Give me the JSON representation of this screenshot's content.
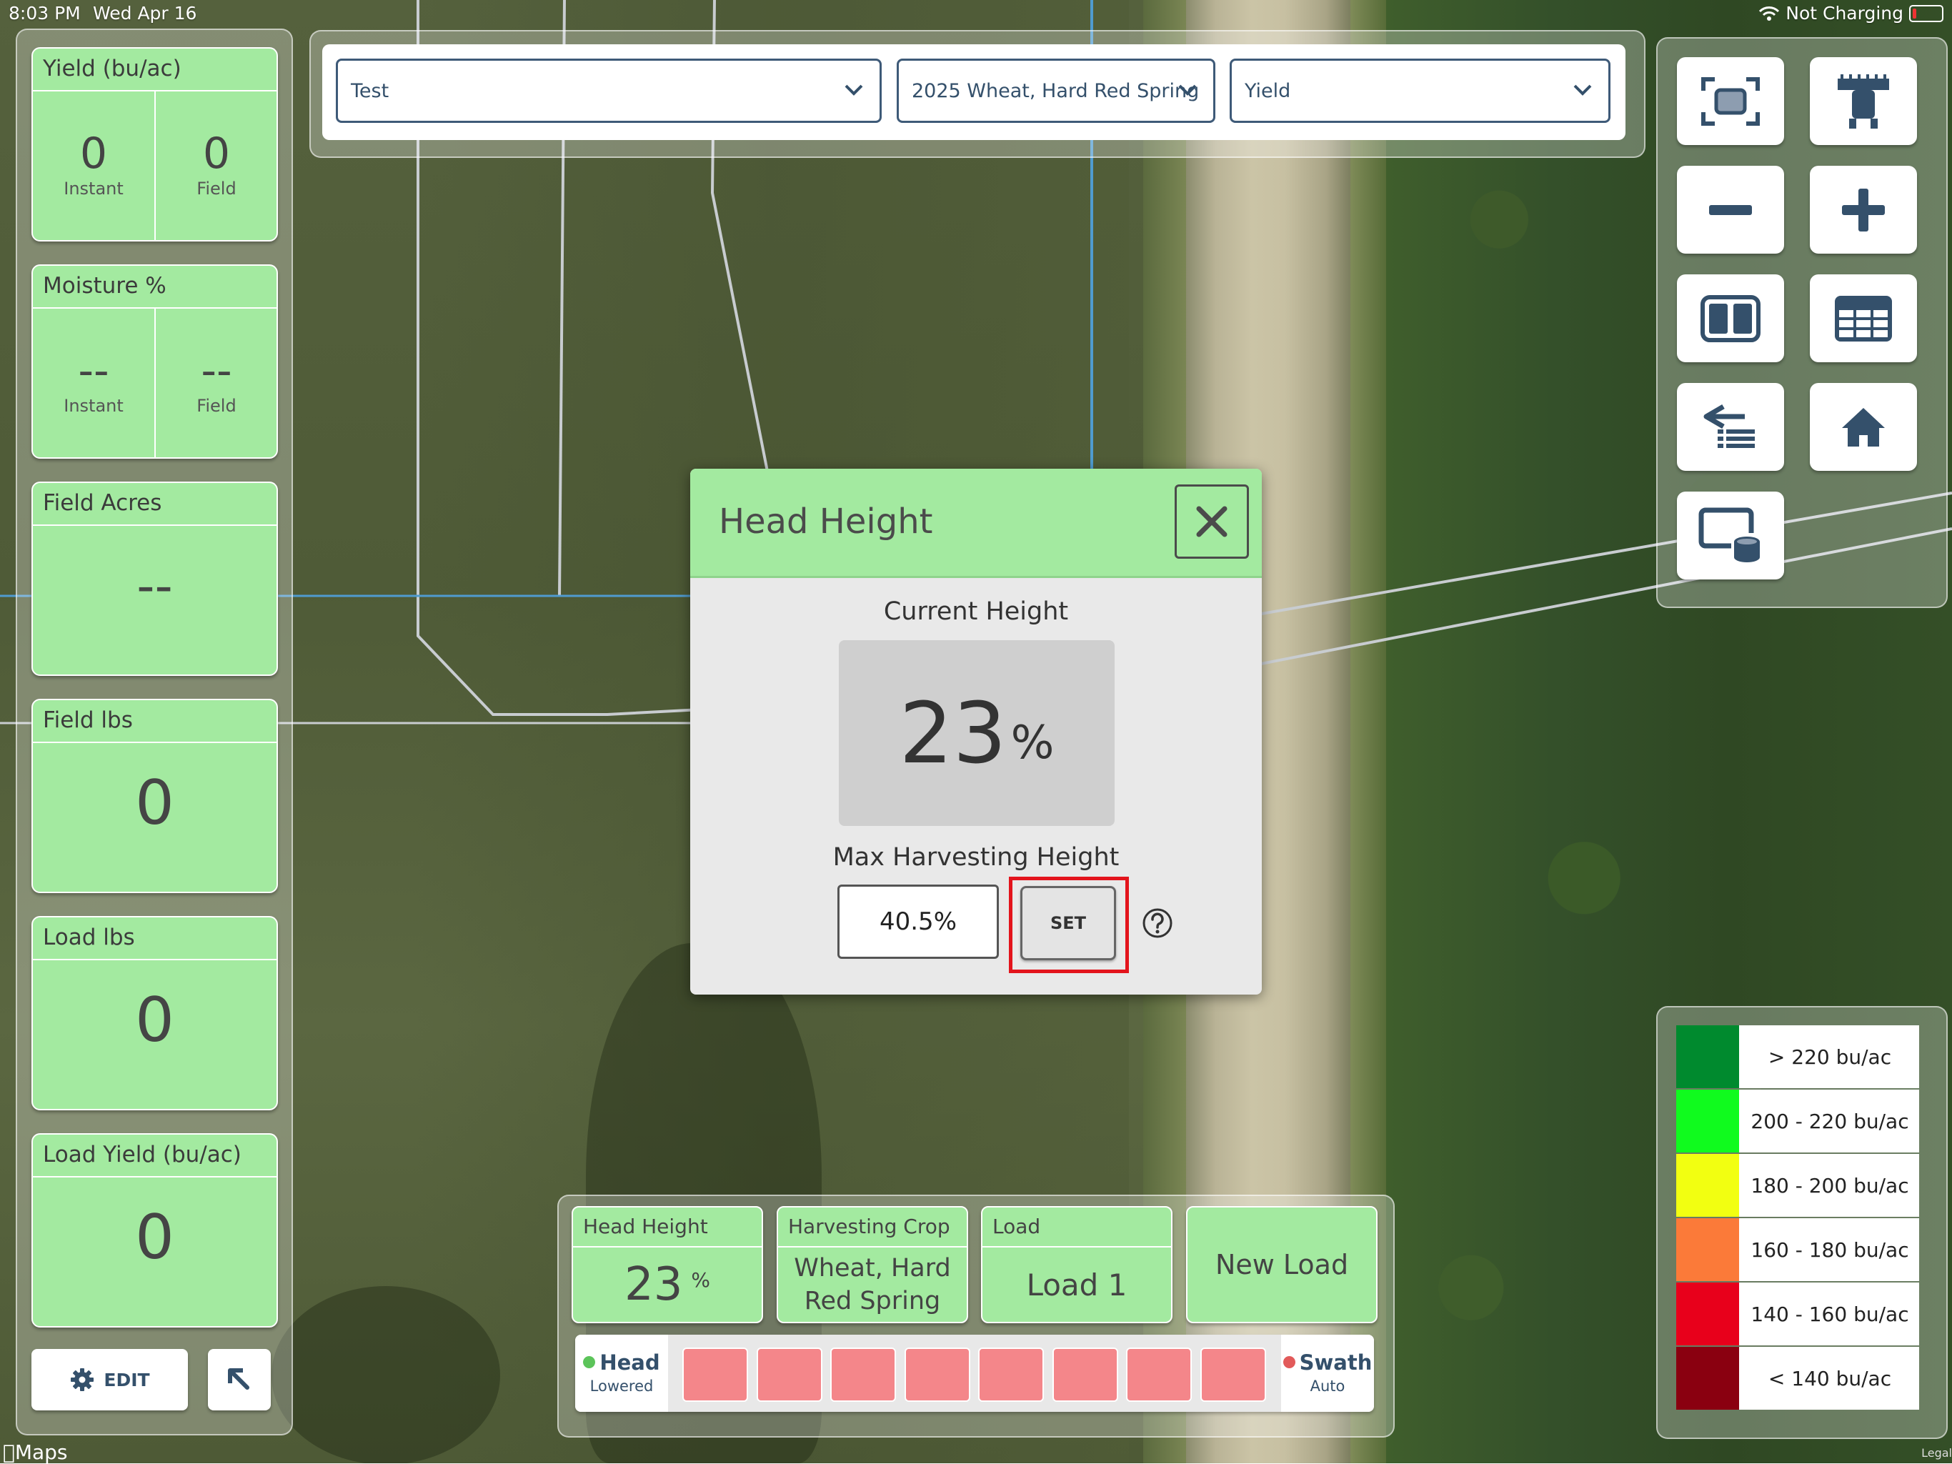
{
  "status_bar": {
    "time": "8:03 PM",
    "date": "Wed Apr 16",
    "charging": "Not Charging"
  },
  "left_tiles": {
    "yield": {
      "title": "Yield (bu/ac)",
      "instant_value": "0",
      "instant_label": "Instant",
      "field_value": "0",
      "field_label": "Field"
    },
    "moisture": {
      "title": "Moisture %",
      "instant_value": "--",
      "instant_label": "Instant",
      "field_value": "--",
      "field_label": "Field"
    },
    "field_acres": {
      "title": "Field Acres",
      "value": "--"
    },
    "field_lbs": {
      "title": "Field lbs",
      "value": "0"
    },
    "load_lbs": {
      "title": "Load lbs",
      "value": "0"
    },
    "load_yield": {
      "title": "Load Yield (bu/ac)",
      "value": "0"
    },
    "edit_label": "EDIT"
  },
  "top_bar": {
    "field": "Test",
    "crop": "2025 Wheat, Hard Red Spring",
    "layer": "Yield"
  },
  "legend": [
    {
      "label": "> 220 bu/ac",
      "color": "#008a2e"
    },
    {
      "label": "200 - 220 bu/ac",
      "color": "#10fb1e"
    },
    {
      "label": "180 - 200 bu/ac",
      "color": "#f2ff11"
    },
    {
      "label": "160 - 180 bu/ac",
      "color": "#fb7a39"
    },
    {
      "label": "140 - 160 bu/ac",
      "color": "#e8001b"
    },
    {
      "label": "< 140 bu/ac",
      "color": "#8a0010"
    }
  ],
  "bottom": {
    "head_height": {
      "title": "Head Height",
      "value": "23",
      "unit": "%"
    },
    "crop": {
      "title": "Harvesting Crop",
      "line1": "Wheat, Hard",
      "line2": "Red Spring"
    },
    "load": {
      "title": "Load",
      "value": "Load 1"
    },
    "new_load": "New Load",
    "head_status": {
      "label": "Head",
      "state": "Lowered",
      "color": "#5cc45a"
    },
    "swath_status": {
      "label": "Swath",
      "state": "Auto",
      "color": "#e25a5a"
    },
    "section_count": 8,
    "section_color": "#f4868a"
  },
  "modal": {
    "title": "Head Height",
    "current_label": "Current Height",
    "current_value": "23",
    "current_unit": "%",
    "max_label": "Max Harvesting Height",
    "max_value": "40.5%",
    "set_label": "SET"
  },
  "icons": {
    "tools": [
      "fit-screen-icon",
      "combine-icon",
      "zoom-out-icon",
      "zoom-in-icon",
      "split-view-icon",
      "table-view-icon",
      "layers-list-icon",
      "home-icon",
      "screen-storage-icon"
    ]
  },
  "credits": {
    "maps": "Maps",
    "legal": "Legal"
  }
}
